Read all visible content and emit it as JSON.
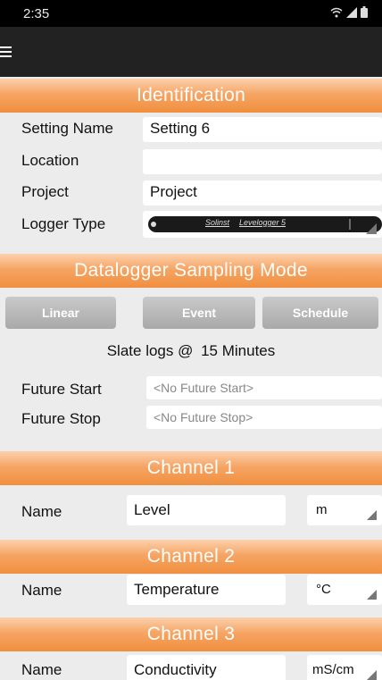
{
  "status_bar": {
    "time": "2:35",
    "icons": [
      "wifi-icon",
      "signal-icon",
      "battery-icon"
    ]
  },
  "toolbar": {
    "menu_icon": "hamburger-menu-icon"
  },
  "identification": {
    "header": "Identification",
    "setting_name_label": "Setting Name",
    "setting_name_value": "Setting 6",
    "location_label": "Location",
    "location_value": "",
    "project_label": "Project",
    "project_value": "Project",
    "logger_type_label": "Logger Type",
    "logger_brand": "Solinst",
    "logger_model": "Levelogger 5"
  },
  "sampling": {
    "header": "Datalogger Sampling Mode",
    "modes": [
      "Linear",
      "Event",
      "Schedule"
    ],
    "slate_prefix": "Slate logs @",
    "slate_interval": "15 Minutes",
    "future_start_label": "Future Start",
    "future_start_placeholder": "<No Future Start>",
    "future_stop_label": "Future Stop",
    "future_stop_placeholder": "<No Future Stop>"
  },
  "channels": [
    {
      "header": "Channel 1",
      "name_label": "Name",
      "name_value": "Level",
      "unit": "m"
    },
    {
      "header": "Channel 2",
      "name_label": "Name",
      "name_value": "Temperature",
      "unit": "°C"
    },
    {
      "header": "Channel 3",
      "name_label": "Name",
      "name_value": "Conductivity",
      "unit": "mS/cm"
    }
  ],
  "colors": {
    "header_orange": "#f08f3e",
    "toolbar_dark": "#222222",
    "button_gray": "#b5b5b5",
    "background": "#ececec"
  }
}
